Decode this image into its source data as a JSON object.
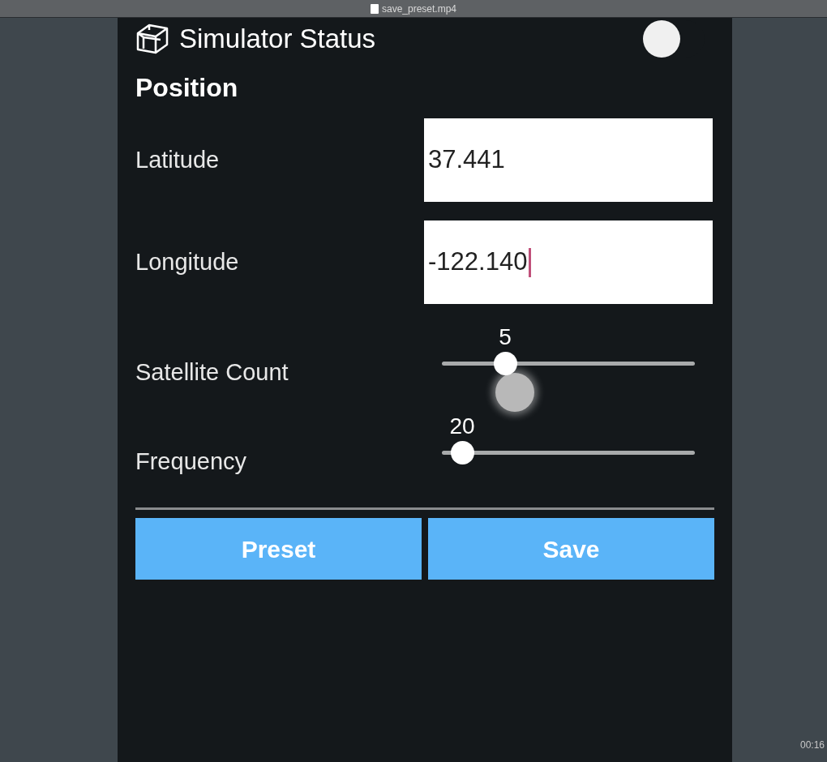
{
  "window": {
    "title": "save_preset.mp4",
    "time": "00:16"
  },
  "app": {
    "title": "Simulator Status",
    "toggle": {
      "on": false
    }
  },
  "section": "Position",
  "fields": [
    {
      "label": "Latitude",
      "value": "37.441",
      "focused": false
    },
    {
      "label": "Longitude",
      "value": "-122.140",
      "focused": true
    }
  ],
  "sliders": [
    {
      "label": "Satellite Count",
      "reading": "5",
      "level": 0.25,
      "touched": true
    },
    {
      "label": "Frequency",
      "reading": "20",
      "level": 0.08,
      "touched": false
    }
  ],
  "buttons": [
    "Preset",
    "Save"
  ]
}
